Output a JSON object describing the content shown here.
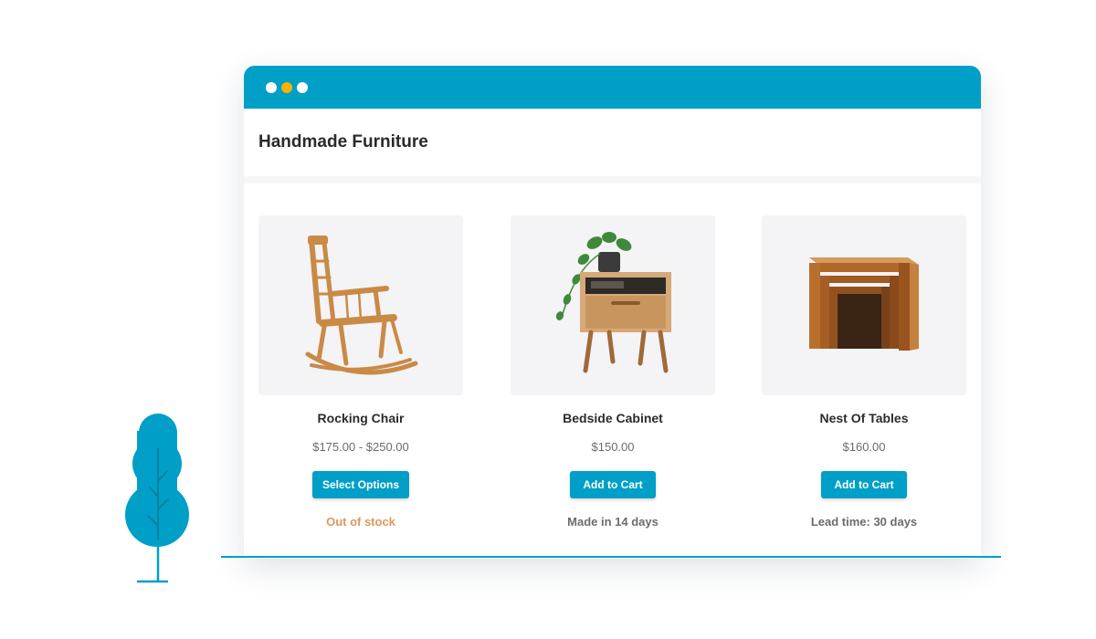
{
  "colors": {
    "brand": "#009fc7",
    "dot_white": "#ffffff",
    "dot_yellow": "#f5b300",
    "out_of_stock": "#e0975a",
    "note_gray": "#6c6c6c",
    "wood": "#c98a46"
  },
  "window": {
    "dots": [
      "white",
      "yellow",
      "white"
    ]
  },
  "page": {
    "title": "Handmade Furniture"
  },
  "products": [
    {
      "name": "Rocking Chair",
      "price": "$175.00 - $250.00",
      "button_label": "Select Options",
      "note": "Out of stock",
      "note_status": "out-of-stock",
      "image_icon": "rocking-chair-image"
    },
    {
      "name": "Bedside Cabinet",
      "price": "$150.00",
      "button_label": "Add to Cart",
      "note": "Made in 14 days",
      "note_status": "info",
      "image_icon": "bedside-cabinet-image"
    },
    {
      "name": "Nest Of Tables",
      "price": "$160.00",
      "button_label": "Add to Cart",
      "note": "Lead time: 30 days",
      "note_status": "info",
      "image_icon": "nest-of-tables-image"
    }
  ],
  "decoration": {
    "tree_icon": "tree-icon",
    "ground_line": "ground-line"
  }
}
